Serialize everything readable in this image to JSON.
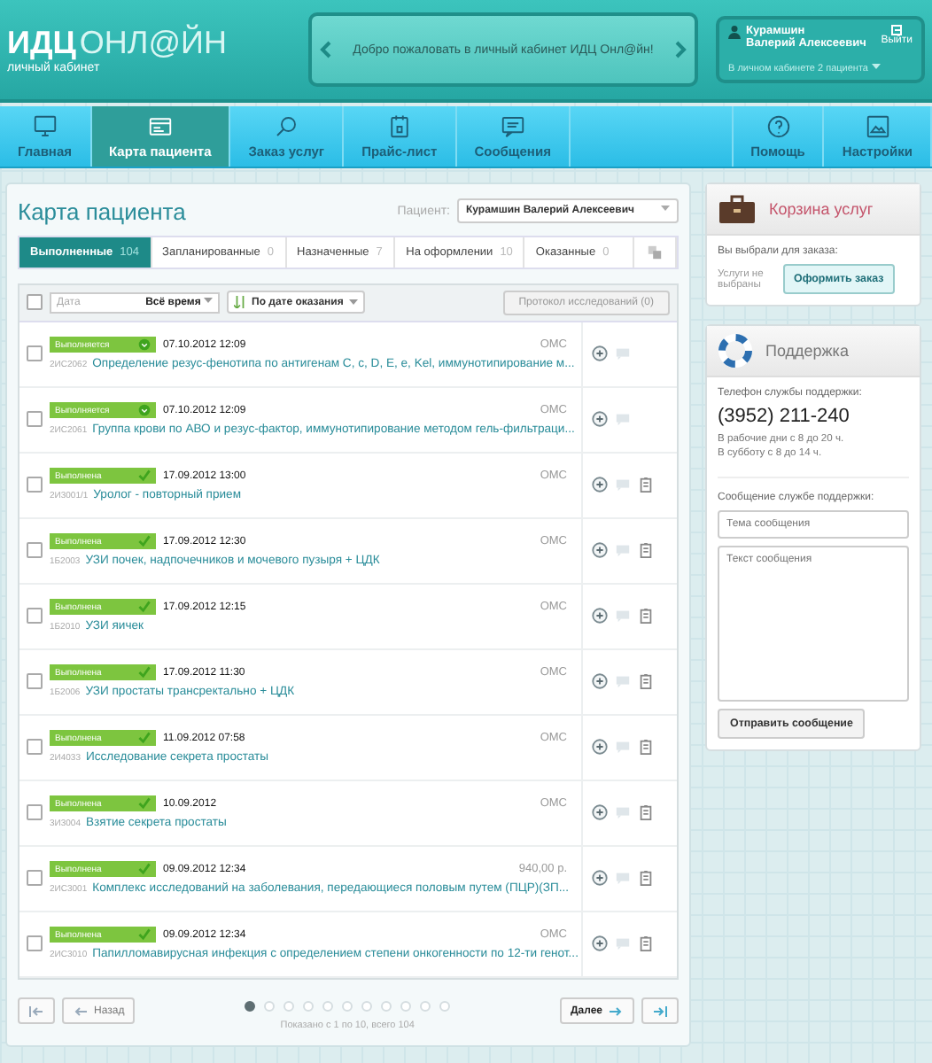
{
  "header": {
    "logo_bold": "ИДЦ",
    "logo_light": "ОНЛ@ЙН",
    "subtitle": "личный кабинет",
    "banner": "Добро пожаловать в личный кабинет ИДЦ Онл@йн!",
    "user_name": "Курамшин\nВалерий Алексеевич",
    "logout": "Выйти",
    "patients_link": "В личном кабинете 2 пациента"
  },
  "nav": [
    {
      "label": "Главная",
      "selected": false
    },
    {
      "label": "Карта пациента",
      "selected": true
    },
    {
      "label": "Заказ услуг",
      "selected": false
    },
    {
      "label": "Прайс-лист",
      "selected": false
    },
    {
      "label": "Сообщения",
      "selected": false
    },
    {
      "label": "Помощь",
      "selected": false
    },
    {
      "label": "Настройки",
      "selected": false
    }
  ],
  "card": {
    "title": "Карта пациента",
    "patient_label": "Пациент:",
    "patient": "Курамшин Валерий Алексеевич",
    "tabs": [
      {
        "label": "Выполненные",
        "count": "104",
        "selected": true
      },
      {
        "label": "Запланированные",
        "count": "0",
        "selected": false
      },
      {
        "label": "Назначенные",
        "count": "7",
        "selected": false
      },
      {
        "label": "На оформлении",
        "count": "10",
        "selected": false
      },
      {
        "label": "Оказанные",
        "count": "0",
        "selected": false
      }
    ],
    "filter": {
      "checked": false,
      "date_placeholder": "Дата",
      "period": "Всё время",
      "sort": "По дате оказания",
      "protocol_button": "Протокол исследований (0)"
    },
    "rows": [
      {
        "status": "Выполняется",
        "kind": "running",
        "date": "07.10.2012 12:09",
        "code": "2ИС2062",
        "name": "Определение резус-фенотипа по антигенам C, c, D, E, e, Kel, иммунотипирование м...",
        "payment": "ОМС",
        "report": false,
        "checked": false
      },
      {
        "status": "Выполняется",
        "kind": "running",
        "date": "07.10.2012 12:09",
        "code": "2ИС2061",
        "name": "Группа крови по АВО и резус-фактор, иммунотипирование методом гель-фильтраци...",
        "payment": "ОМС",
        "report": false,
        "checked": false
      },
      {
        "status": "Выполнена",
        "kind": "done",
        "date": "17.09.2012 13:00",
        "code": "2И3001/1",
        "name": "Уролог - повторный прием",
        "payment": "ОМС",
        "report": true,
        "checked": false
      },
      {
        "status": "Выполнена",
        "kind": "done",
        "date": "17.09.2012 12:30",
        "code": "1Б2003",
        "name": "УЗИ почек, надпочечников и мочевого пузыря + ЦДК",
        "payment": "ОМС",
        "report": true,
        "checked": false
      },
      {
        "status": "Выполнена",
        "kind": "done",
        "date": "17.09.2012 12:15",
        "code": "1Б2010",
        "name": "УЗИ яичек",
        "payment": "ОМС",
        "report": true,
        "checked": false
      },
      {
        "status": "Выполнена",
        "kind": "done",
        "date": "17.09.2012 11:30",
        "code": "1Б2006",
        "name": "УЗИ простаты трансректально + ЦДК",
        "payment": "ОМС",
        "report": true,
        "checked": false
      },
      {
        "status": "Выполнена",
        "kind": "done",
        "date": "11.09.2012 07:58",
        "code": "2И4033",
        "name": "Исследование секрета простаты",
        "payment": "ОМС",
        "report": true,
        "checked": false
      },
      {
        "status": "Выполнена",
        "kind": "done",
        "date": "10.09.2012",
        "code": "3И3004",
        "name": "Взятие секрета простаты",
        "payment": "ОМС",
        "report": true,
        "checked": false
      },
      {
        "status": "Выполнена",
        "kind": "done",
        "date": "09.09.2012 12:34",
        "code": "2ИС3001",
        "name": "Комплекс исследований на заболевания, передающиеся половым путем (ПЦР)(ЗП...",
        "payment": "940,00 р.",
        "report": true,
        "checked": false
      },
      {
        "status": "Выполнена",
        "kind": "done",
        "date": "09.09.2012 12:34",
        "code": "2ИС3010",
        "name": "Папилломавирусная инфекция с определением степени онкогенности по 12-ти генот...",
        "payment": "ОМС",
        "report": true,
        "checked": false
      }
    ],
    "pager": {
      "back": "Назад",
      "next": "Далее",
      "summary": "Показано с 1 по 10, всего 104",
      "pages": [
        {
          "selected": true
        },
        {
          "selected": false
        },
        {
          "selected": false
        },
        {
          "selected": false
        },
        {
          "selected": false
        },
        {
          "selected": false
        },
        {
          "selected": false
        },
        {
          "selected": false
        },
        {
          "selected": false
        },
        {
          "selected": false
        },
        {
          "selected": false
        }
      ]
    }
  },
  "basket": {
    "title": "Корзина услуг",
    "chosen_label": "Вы выбрали для заказа:",
    "empty": "Услуги не выбраны",
    "order_button": "Оформить заказ"
  },
  "support": {
    "title": "Поддержка",
    "phone_label": "Телефон службы поддержки:",
    "phone": "(3952) 211-240",
    "hours": "В рабочие дни с 8 до 20 ч.\nВ субботу с 8 до 14 ч.",
    "message_label": "Сообщение службе поддержки:",
    "subject_placeholder": "Тема сообщения",
    "text_placeholder": "Текст сообщения",
    "send_button": "Отправить сообщение"
  }
}
